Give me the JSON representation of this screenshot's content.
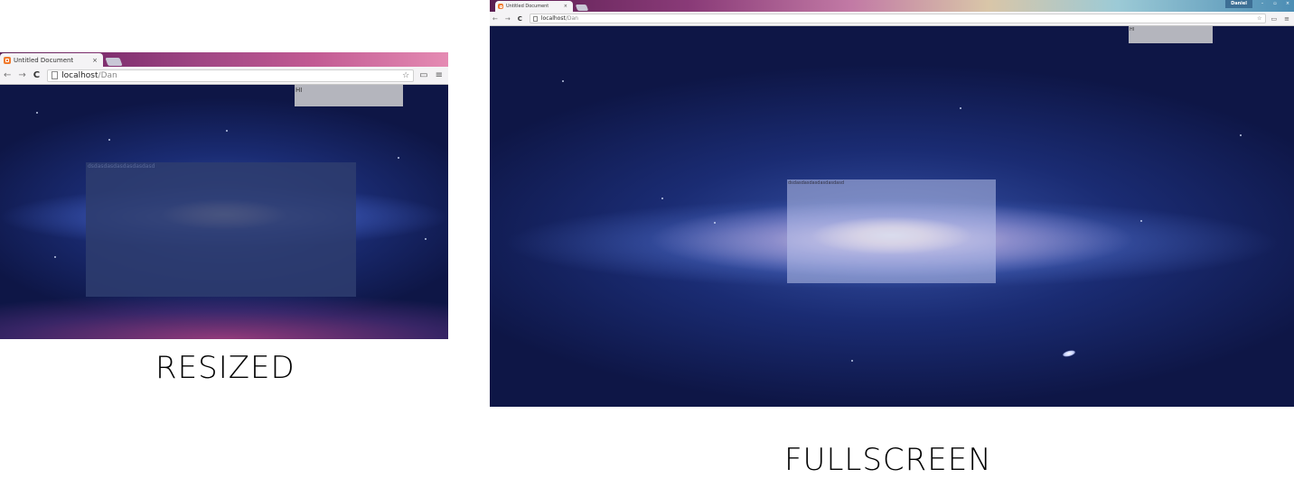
{
  "captions": {
    "resized": "RESIZED",
    "fullscreen": "FULLSCREEN"
  },
  "browser": {
    "tab_title": "Untitled Document",
    "tab_close": "×",
    "url_host": "localhost",
    "url_path": "/Dan",
    "nav": {
      "back": "←",
      "forward": "→",
      "reload": "C"
    },
    "star": "☆",
    "cast": "▭",
    "menu": "≡"
  },
  "window": {
    "user": "Daniel",
    "minimize": "–",
    "restore": "▫",
    "close": "×"
  },
  "page": {
    "hi_text": "HI",
    "content_text": "dsdasdasdasdasdasdasd"
  },
  "colors": {
    "tabstrip": "#a04684",
    "overlay_gray": "#bebec4",
    "background": "#0b1236"
  }
}
